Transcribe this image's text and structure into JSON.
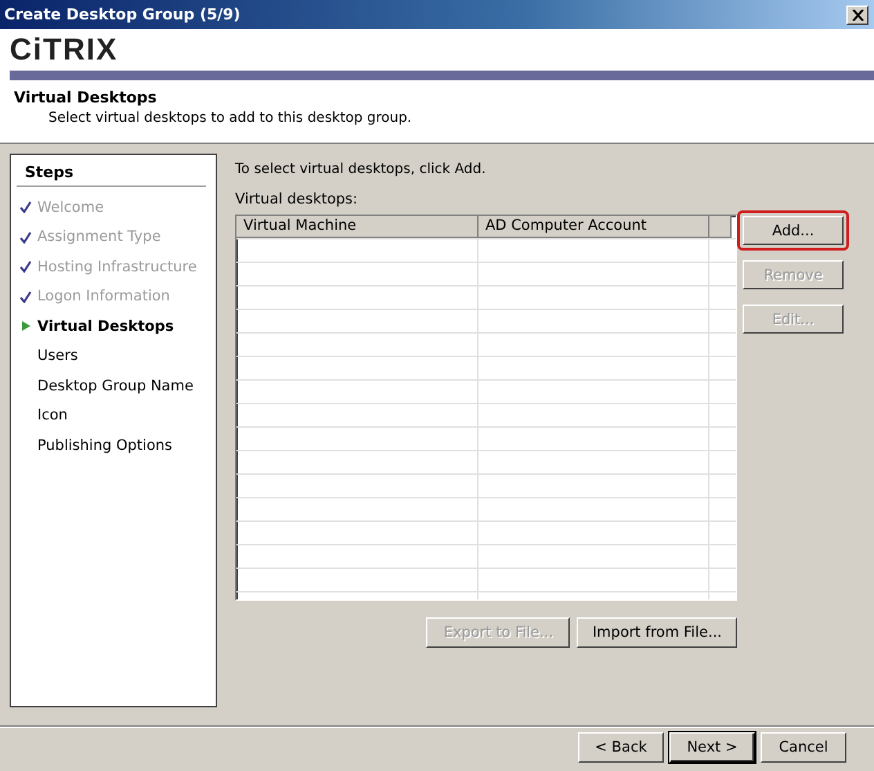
{
  "window": {
    "title": "Create Desktop Group (5/9)"
  },
  "header": {
    "logo": "CiTRIX",
    "title": "Virtual Desktops",
    "subtitle": "Select virtual desktops to add to this desktop group."
  },
  "steps": {
    "title": "Steps",
    "items": [
      {
        "label": "Welcome",
        "done": true,
        "selected": false
      },
      {
        "label": "Assignment Type",
        "done": true,
        "selected": false
      },
      {
        "label": "Hosting Infrastructure",
        "done": true,
        "selected": false
      },
      {
        "label": "Logon Information",
        "done": true,
        "selected": false
      },
      {
        "label": "Virtual Desktops",
        "done": false,
        "selected": true
      },
      {
        "label": "Users",
        "done": false,
        "selected": false
      },
      {
        "label": "Desktop Group Name",
        "done": false,
        "selected": false
      },
      {
        "label": "Icon",
        "done": false,
        "selected": false
      },
      {
        "label": "Publishing Options",
        "done": false,
        "selected": false
      }
    ]
  },
  "content": {
    "instruction": "To select virtual desktops, click Add.",
    "list_label": "Virtual desktops:",
    "table": {
      "columns": [
        "Virtual Machine",
        "AD Computer Account"
      ]
    },
    "side_buttons": [
      {
        "label": "Add...",
        "disabled": false,
        "highlighted": true
      },
      {
        "label": "Remove",
        "disabled": true,
        "highlighted": false
      },
      {
        "label": "Edit...",
        "disabled": true,
        "highlighted": false
      }
    ],
    "file_buttons": [
      {
        "label": "Export to File...",
        "disabled": true
      },
      {
        "label": "Import from File...",
        "disabled": false
      }
    ]
  },
  "footer_buttons": [
    {
      "label": "< Back",
      "default": false
    },
    {
      "label": "Next >",
      "default": true
    },
    {
      "label": "Cancel",
      "default": false
    }
  ]
}
